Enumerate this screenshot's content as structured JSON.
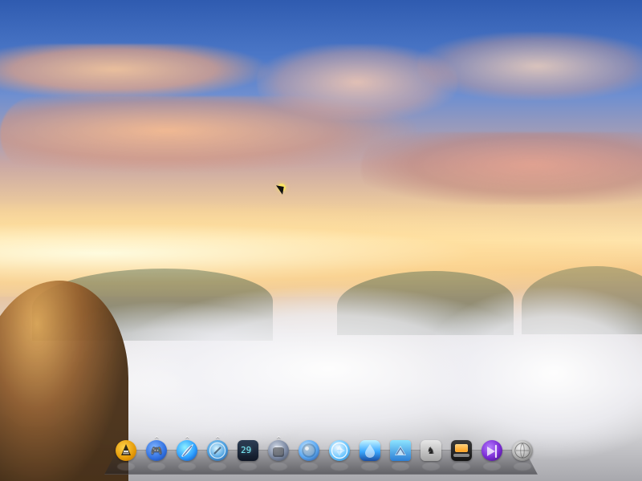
{
  "screen": {
    "title": "",
    "wallpaper": {
      "type": "misty-sunrise-landscape",
      "colors": {
        "sky_top": "#2f5bb0",
        "sky_mid": "#6f8fd0",
        "sun_glow": "#ffe6b0",
        "fog": "#f0f0f5"
      }
    }
  },
  "cursor": {
    "icon": "mouse-cursor-icon"
  },
  "dock": {
    "items": [
      {
        "id": "vlc",
        "icon": "vlc-icon",
        "badge": ""
      },
      {
        "id": "gamepad",
        "icon": "gamepad-icon",
        "badge": "^"
      },
      {
        "id": "feather",
        "icon": "feather-icon",
        "badge": "^"
      },
      {
        "id": "safari",
        "icon": "safari-icon",
        "badge": "^"
      },
      {
        "id": "terminal",
        "icon": "terminal-icon",
        "badge": "",
        "text": "29"
      },
      {
        "id": "stack",
        "icon": "stack-icon",
        "badge": "^"
      },
      {
        "id": "cinema",
        "icon": "cinema-4d-icon",
        "badge": ""
      },
      {
        "id": "aperture",
        "icon": "aperture-icon",
        "badge": ""
      },
      {
        "id": "drop",
        "icon": "water-drop-icon",
        "badge": ""
      },
      {
        "id": "blueprint",
        "icon": "blueprint-icon",
        "badge": ""
      },
      {
        "id": "horse",
        "icon": "horse-icon",
        "badge": ""
      },
      {
        "id": "laptop",
        "icon": "laptop-icon",
        "badge": ""
      },
      {
        "id": "vs",
        "icon": "visual-studio-icon",
        "badge": ""
      },
      {
        "id": "globe",
        "icon": "globe-icon",
        "badge": ""
      }
    ]
  }
}
